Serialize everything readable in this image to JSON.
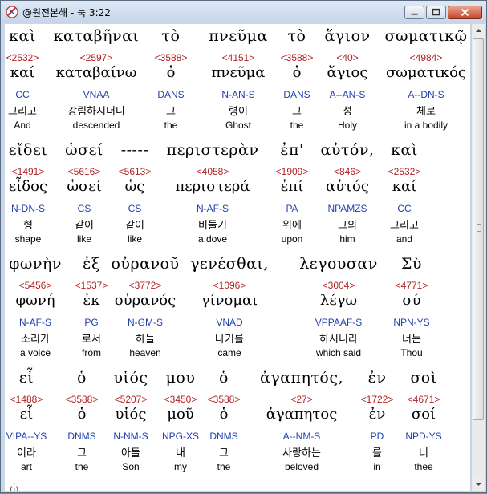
{
  "window": {
    "title": "@원전본해 - 눅 3:22"
  },
  "rows": [
    [
      {
        "greek": "καὶ",
        "strong": "<2532>",
        "lemma": "καί",
        "parse": "CC",
        "kor": "그리고",
        "eng": "And"
      },
      {
        "greek": "καταβῆναι",
        "strong": "<2597>",
        "lemma": "καταβαίνω",
        "parse": "VNAA",
        "kor": "강림하시더니",
        "eng": "descended"
      },
      {
        "greek": "τὸ",
        "strong": "<3588>",
        "lemma": "ὁ",
        "parse": "DANS",
        "kor": "그",
        "eng": "the"
      },
      {
        "greek": "πνεῦμα",
        "strong": "<4151>",
        "lemma": "πνεῦμα",
        "parse": "N-AN-S",
        "kor": "령이",
        "eng": "Ghost"
      },
      {
        "greek": "τὸ",
        "strong": "<3588>",
        "lemma": "ὁ",
        "parse": "DANS",
        "kor": "그",
        "eng": "the"
      },
      {
        "greek": "ἅγιον",
        "strong": "<40>",
        "lemma": "ἅγιος",
        "parse": "A--AN-S",
        "kor": "성",
        "eng": "Holy"
      },
      {
        "greek": "σωματικῷ",
        "strong": "<4984>",
        "lemma": "σωματικός",
        "parse": "A--DN-S",
        "kor": "체로",
        "eng": "in a bodily"
      }
    ],
    [
      {
        "greek": "εἴδει",
        "strong": "<1491>",
        "lemma": "εἶδος",
        "parse": "N-DN-S",
        "kor": "형",
        "eng": "shape"
      },
      {
        "greek": "ὡσεί",
        "strong": "<5616>",
        "lemma": "ὡσεί",
        "parse": "CS",
        "kor": "같이",
        "eng": "like"
      },
      {
        "greek": "-----",
        "strong": "<5613>",
        "lemma": "ὡς",
        "parse": "CS",
        "kor": "같이",
        "eng": "like"
      },
      {
        "greek": "περιστερὰν",
        "strong": "<4058>",
        "lemma": "περιστερά",
        "parse": "N-AF-S",
        "kor": "비둘기",
        "eng": "a dove"
      },
      {
        "greek": "ἐπ'",
        "strong": "<1909>",
        "lemma": "ἐπί",
        "parse": "PA",
        "kor": "위에",
        "eng": "upon"
      },
      {
        "greek": "αὐτόν,",
        "strong": "<846>",
        "lemma": "αὐτός",
        "parse": "NPAMZS",
        "kor": "그의",
        "eng": "him"
      },
      {
        "greek": "καὶ",
        "strong": "<2532>",
        "lemma": "καί",
        "parse": "CC",
        "kor": "그리고",
        "eng": "and"
      }
    ],
    [
      {
        "greek": "φωνὴν",
        "strong": "<5456>",
        "lemma": "φωνή",
        "parse": "N-AF-S",
        "kor": "소리가",
        "eng": "a voice"
      },
      {
        "greek": "ἐξ",
        "strong": "<1537>",
        "lemma": "ἐκ",
        "parse": "PG",
        "kor": "로서",
        "eng": "from"
      },
      {
        "greek": "οὐρανοῦ",
        "strong": "<3772>",
        "lemma": "οὐρανός",
        "parse": "N-GM-S",
        "kor": "하늘",
        "eng": "heaven"
      },
      {
        "greek": "γενέσθαι,",
        "strong": "<1096>",
        "lemma": "γίνομαι",
        "parse": "VNAD",
        "kor": "나기를",
        "eng": "came"
      },
      {
        "greek": "λεγουσαν",
        "strong": "<3004>",
        "lemma": "λέγω",
        "parse": "VPPAAF-S",
        "kor": "하시니라",
        "eng": "which said"
      },
      {
        "greek": "Σὺ",
        "strong": "<4771>",
        "lemma": "σύ",
        "parse": "NPN-YS",
        "kor": "너는",
        "eng": "Thou"
      }
    ],
    [
      {
        "greek": "εἶ",
        "strong": "<1488>",
        "lemma": "εἶ",
        "parse": "VIPA--YS",
        "kor": "이라",
        "eng": "art"
      },
      {
        "greek": "ὁ",
        "strong": "<3588>",
        "lemma": "ὁ",
        "parse": "DNMS",
        "kor": "그",
        "eng": "the"
      },
      {
        "greek": "υἱός",
        "strong": "<5207>",
        "lemma": "υἱός",
        "parse": "N-NM-S",
        "kor": "아들",
        "eng": "Son"
      },
      {
        "greek": "μου",
        "strong": "<3450>",
        "lemma": "μοῦ",
        "parse": "NPG-XS",
        "kor": "내",
        "eng": "my"
      },
      {
        "greek": "ὁ",
        "strong": "<3588>",
        "lemma": "ὁ",
        "parse": "DNMS",
        "kor": "그",
        "eng": "the"
      },
      {
        "greek": "ἀγαπητός,",
        "strong": "<27>",
        "lemma": "ἀγαπητος",
        "parse": "A--NM-S",
        "kor": "사랑하는",
        "eng": "beloved"
      },
      {
        "greek": "ἐν",
        "strong": "<1722>",
        "lemma": "ἐν",
        "parse": "PD",
        "kor": "를",
        "eng": "in"
      },
      {
        "greek": "σοὶ",
        "strong": "<4671>",
        "lemma": "σοί",
        "parse": "NPD-YS",
        "kor": "너",
        "eng": "thee"
      }
    ]
  ],
  "next_partial": "ὡ ...",
  "colors": {
    "strong": "#b22222",
    "parse": "#1f3fb0",
    "window_title_bg": "#c5d5ea"
  }
}
